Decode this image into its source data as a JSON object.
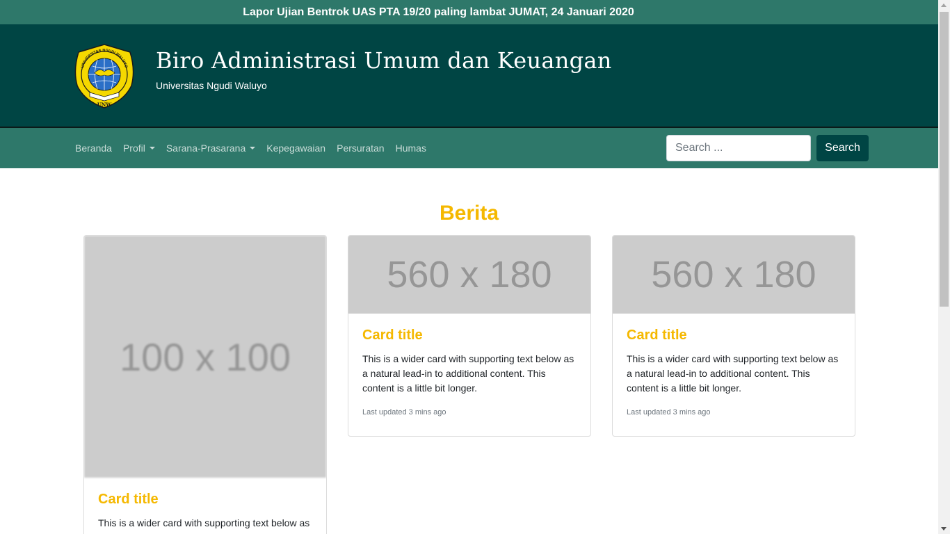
{
  "announcement": "Lapor Ujian Bentrok UAS PTA 19/20 paling lambat JUMAT, 24 Januari 2020",
  "header": {
    "title": "Biro Administrasi Umum dan Keuangan",
    "subtitle": "Universitas Ngudi Waluyo",
    "logo": {
      "ring_text": "UNIVERSITAS NGUDI WALUYO",
      "abbreviation": "UNW",
      "colors": {
        "shield": "#f5d800",
        "globe": "#2b6fc7",
        "outline": "#1a1a1a"
      }
    }
  },
  "nav": {
    "items": [
      {
        "label": "Beranda",
        "dropdown": false
      },
      {
        "label": "Profil",
        "dropdown": true
      },
      {
        "label": "Sarana-Prasarana",
        "dropdown": true
      },
      {
        "label": "Kepegawaian",
        "dropdown": false
      },
      {
        "label": "Persuratan",
        "dropdown": false
      },
      {
        "label": "Humas",
        "dropdown": false
      }
    ],
    "search": {
      "placeholder": "Search ...",
      "value": "",
      "button_label": "Search"
    }
  },
  "main": {
    "section_title": "Berita",
    "cards": [
      {
        "image_label": "100 x 100",
        "title": "Card title",
        "text": "This is a wider card with supporting text below as",
        "meta": ""
      },
      {
        "image_label": "560 x 180",
        "title": "Card title",
        "text": "This is a wider card with supporting text below as a natural lead-in to additional content. This content is a little bit longer.",
        "meta": "Last updated 3 mins ago"
      },
      {
        "image_label": "560 x 180",
        "title": "Card title",
        "text": "This is a wider card with supporting text below as a natural lead-in to additional content. This content is a little bit longer.",
        "meta": "Last updated 3 mins ago"
      }
    ]
  },
  "colors": {
    "announcement_bg": "#2e786a",
    "header_bg": "#004544",
    "navbar_bg": "#2e786a",
    "accent": "#f5b800",
    "search_button_bg": "#004544",
    "placeholder_bg": "#cccccc"
  }
}
